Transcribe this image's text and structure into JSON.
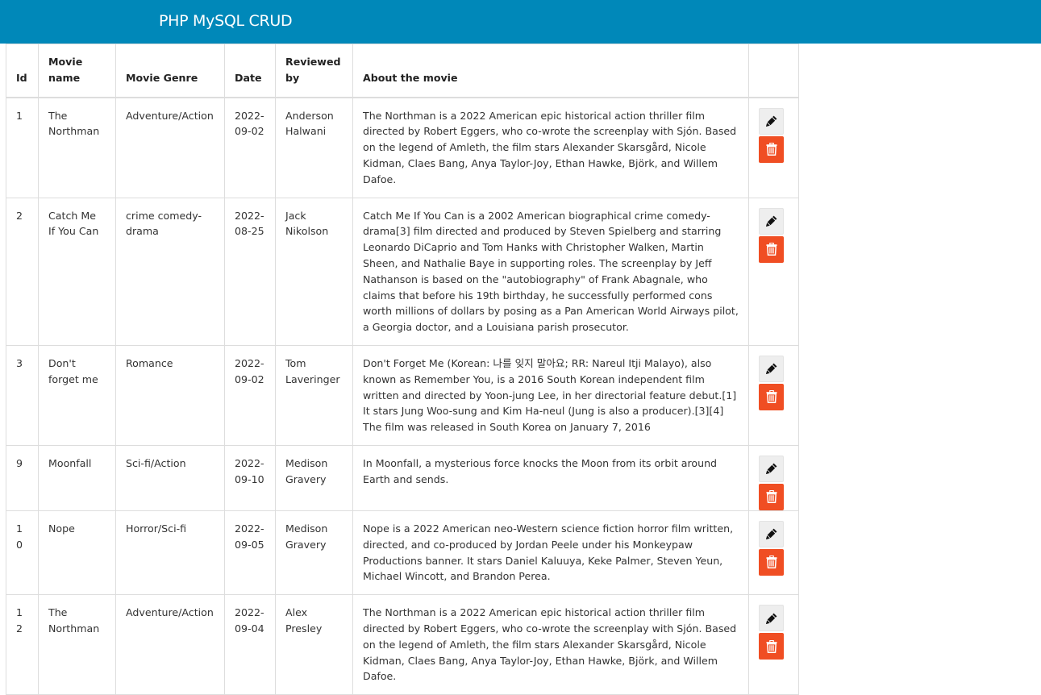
{
  "navbar": {
    "brand": "PHP MySQL CRUD"
  },
  "table": {
    "headers": {
      "id": "Id",
      "name": "Movie name",
      "genre": "Movie Genre",
      "date": "Date",
      "reviewed_by": "Reviewed by",
      "about": "About the movie"
    },
    "rows": [
      {
        "id": "1",
        "name": "The Northman",
        "genre": "Adventure/Action",
        "date": "2022-09-02",
        "reviewed_by": "Anderson Halwani",
        "about": "The Northman is a 2022 American epic historical action thriller film directed by Robert Eggers, who co-wrote the screenplay with Sjón. Based on the legend of Amleth, the film stars Alexander Skarsgård, Nicole Kidman, Claes Bang, Anya Taylor-Joy, Ethan Hawke, Björk, and Willem Dafoe."
      },
      {
        "id": "2",
        "name": "Catch Me If You Can",
        "genre": "crime comedy-drama",
        "date": "2022-08-25",
        "reviewed_by": "Jack Nikolson",
        "about": "Catch Me If You Can is a 2002 American biographical crime comedy-drama[3] film directed and produced by Steven Spielberg and starring Leonardo DiCaprio and Tom Hanks with Christopher Walken, Martin Sheen, and Nathalie Baye in supporting roles. The screenplay by Jeff Nathanson is based on the \"autobiography\" of Frank Abagnale, who claims that before his 19th birthday, he successfully performed cons worth millions of dollars by posing as a Pan American World Airways pilot, a Georgia doctor, and a Louisiana parish prosecutor."
      },
      {
        "id": "3",
        "name": "Don't forget me",
        "genre": "Romance",
        "date": "2022-09-02",
        "reviewed_by": "Tom Laveringer",
        "about": "Don't Forget Me (Korean: 나를 잊지 말아요; RR: Nareul Itji Malayo), also known as Remember You, is a 2016 South Korean independent film written and directed by Yoon-jung Lee, in her directorial feature debut.[1] It stars Jung Woo-sung and Kim Ha-neul (Jung is also a producer).[3][4] The film was released in South Korea on January 7, 2016"
      },
      {
        "id": "9",
        "name": "Moonfall",
        "genre": "Sci-fi/Action",
        "date": "2022-09-10",
        "reviewed_by": "Medison Gravery",
        "about": "In Moonfall, a mysterious force knocks the Moon from its orbit around Earth and sends."
      },
      {
        "id": "10",
        "name": "Nope",
        "genre": "Horror/Sci-fi",
        "date": "2022-09-05",
        "reviewed_by": "Medison Gravery",
        "about": "Nope is a 2022 American neo-Western science fiction horror film written, directed, and co-produced by Jordan Peele under his Monkeypaw Productions banner. It stars Daniel Kaluuya, Keke Palmer, Steven Yeun, Michael Wincott, and Brandon Perea."
      },
      {
        "id": "12",
        "name": "The Northman",
        "genre": "Adventure/Action",
        "date": "2022-09-04",
        "reviewed_by": "Alex Presley",
        "about": "The Northman is a 2022 American epic historical action thriller film directed by Robert Eggers, who co-wrote the screenplay with Sjón. Based on the legend of Amleth, the film stars Alexander Skarsgård, Nicole Kidman, Claes Bang, Anya Taylor-Joy, Ethan Hawke, Björk, and Willem Dafoe."
      }
    ]
  },
  "icons": {
    "edit": "pen-icon",
    "delete": "trash-icon"
  },
  "colors": {
    "navbar": "#0088b9",
    "delete_button": "#f04e23",
    "edit_button": "#eeeeee"
  }
}
